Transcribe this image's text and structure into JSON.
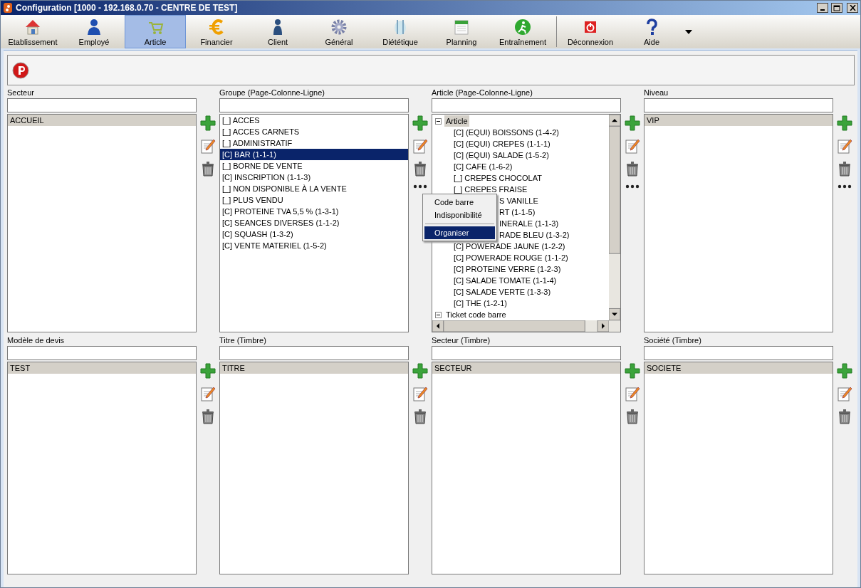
{
  "window": {
    "title": "Configuration [1000 - 192.168.0.70 - CENTRE DE TEST]"
  },
  "toolbar": {
    "groups": [
      [
        {
          "label": "Etablissement",
          "selected": false
        },
        {
          "label": "Employé",
          "selected": false
        },
        {
          "label": "Article",
          "selected": true
        },
        {
          "label": "Financier",
          "selected": false
        },
        {
          "label": "Client",
          "selected": false
        },
        {
          "label": "Général",
          "selected": false
        },
        {
          "label": "Diététique",
          "selected": false
        },
        {
          "label": "Planning",
          "selected": false
        },
        {
          "label": "Entraînement",
          "selected": false
        }
      ],
      [
        {
          "label": "Déconnexion",
          "selected": false
        },
        {
          "label": "Aide",
          "selected": false
        }
      ]
    ]
  },
  "panels": [
    {
      "label": "Secteur",
      "kind": "list",
      "focused": false,
      "more_button": false,
      "items": [
        {
          "text": "ACCUEIL",
          "selected": true
        }
      ]
    },
    {
      "label": "Groupe (Page-Colonne-Ligne)",
      "kind": "list",
      "focused": true,
      "more_button": true,
      "items": [
        {
          "text": "[_] ACCES",
          "selected": false
        },
        {
          "text": "[_] ACCES CARNETS",
          "selected": false
        },
        {
          "text": "[_] ADMINISTRATIF",
          "selected": false
        },
        {
          "text": "[C] BAR (1-1-1)",
          "selected": true
        },
        {
          "text": "[_] BORNE DE VENTE",
          "selected": false
        },
        {
          "text": "[C] INSCRIPTION (1-1-3)",
          "selected": false
        },
        {
          "text": "[_] NON DISPONIBLE À LA VENTE",
          "selected": false
        },
        {
          "text": "[_] PLUS VENDU",
          "selected": false
        },
        {
          "text": "[C] PROTEINE TVA 5,5 % (1-3-1)",
          "selected": false
        },
        {
          "text": "[C] SEANCES DIVERSES (1-1-2)",
          "selected": false
        },
        {
          "text": "[C] SQUASH (1-3-2)",
          "selected": false
        },
        {
          "text": "[C] VENTE MATERIEL (1-5-2)",
          "selected": false
        }
      ]
    },
    {
      "label": "Article (Page-Colonne-Ligne)",
      "kind": "tree",
      "focused": false,
      "more_button": true,
      "items": [
        {
          "text": "Article",
          "selected": true,
          "expanded": true,
          "children": [
            {
              "text": "[C] (EQUI) BOISSONS (1-4-2)",
              "selected": false,
              "kind": "node"
            },
            {
              "text": "[C] (EQUI) CREPES (1-1-1)",
              "selected": false,
              "kind": "node"
            },
            {
              "text": "[C] (EQUI) SALADE (1-5-2)",
              "selected": false,
              "kind": "node"
            },
            {
              "text": "[C] CAFE (1-6-2)",
              "selected": false,
              "kind": "node"
            },
            {
              "text": "[_] CREPES CHOCOLAT",
              "selected": false,
              "kind": "node"
            },
            {
              "text": "[_] CREPES FRAISE",
              "selected": false,
              "kind": "node"
            },
            {
              "text": "S VANILLE",
              "selected": false,
              "kind": "cut"
            },
            {
              "text": "RT (1-1-5)",
              "selected": false,
              "kind": "cut"
            },
            {
              "text": "INERALE (1-1-3)",
              "selected": false,
              "kind": "cut"
            },
            {
              "text": "RADE BLEU (1-3-2)",
              "selected": false,
              "kind": "cut"
            },
            {
              "text": "[C] POWERADE JAUNE (1-2-2)",
              "selected": false,
              "kind": "node"
            },
            {
              "text": "[C] POWERADE ROUGE (1-1-2)",
              "selected": false,
              "kind": "node"
            },
            {
              "text": "[C] PROTEINE VERRE (1-2-3)",
              "selected": false,
              "kind": "node"
            },
            {
              "text": "[C] SALADE TOMATE (1-1-4)",
              "selected": false,
              "kind": "node"
            },
            {
              "text": "[C] SALADE VERTE (1-3-3)",
              "selected": false,
              "kind": "node"
            },
            {
              "text": "[C] THE (1-2-1)",
              "selected": false,
              "kind": "node"
            }
          ]
        },
        {
          "text": "Ticket code barre",
          "selected": false,
          "expanded": true
        }
      ]
    },
    {
      "label": "Niveau",
      "kind": "list",
      "focused": false,
      "more_button": true,
      "items": [
        {
          "text": "VIP",
          "selected": true
        }
      ]
    },
    {
      "label": "Modèle de devis",
      "kind": "list",
      "focused": false,
      "more_button": false,
      "items": [
        {
          "text": "TEST",
          "selected": true
        }
      ]
    },
    {
      "label": "Titre (Timbre)",
      "kind": "list",
      "focused": false,
      "more_button": false,
      "items": [
        {
          "text": "TITRE",
          "selected": true
        }
      ]
    },
    {
      "label": "Secteur (Timbre)",
      "kind": "list",
      "focused": false,
      "more_button": false,
      "items": [
        {
          "text": "SECTEUR",
          "selected": true
        }
      ]
    },
    {
      "label": "Société (Timbre)",
      "kind": "list",
      "focused": false,
      "more_button": false,
      "items": [
        {
          "text": "SOCIETE",
          "selected": true
        }
      ]
    }
  ],
  "context_menu": {
    "items": [
      {
        "kind": "item",
        "text": "Code barre",
        "selected": false
      },
      {
        "kind": "item",
        "text": "Indisponibilité",
        "selected": false
      },
      {
        "kind": "separator"
      },
      {
        "kind": "item",
        "text": "Organiser",
        "selected": true
      }
    ]
  }
}
